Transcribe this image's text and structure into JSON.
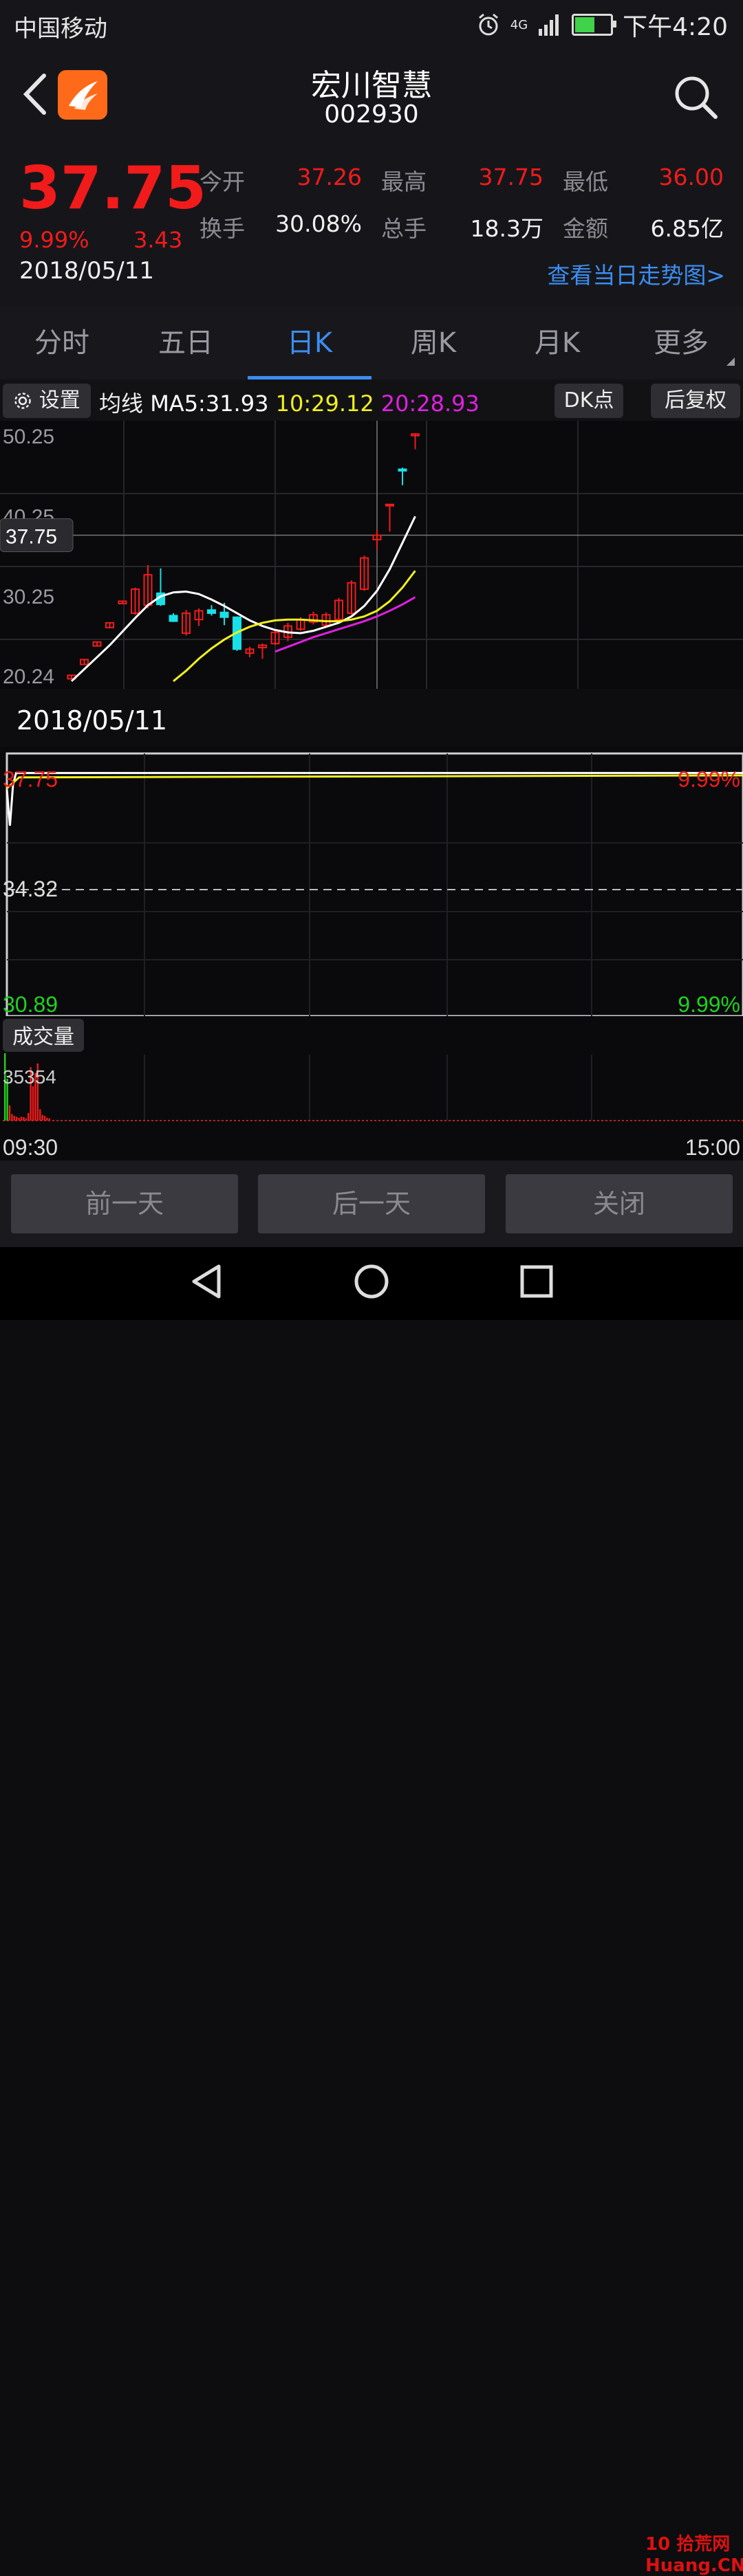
{
  "status_bar": {
    "carrier": "中国移动",
    "network": "4G",
    "time": "下午4:20"
  },
  "header": {
    "title": "宏川智慧",
    "code": "002930"
  },
  "quote": {
    "price": "37.75",
    "change_pct": "9.99%",
    "change": "3.43",
    "date": "2018/05/11",
    "open_label": "今开",
    "open": "37.26",
    "high_label": "最高",
    "high": "37.75",
    "low_label": "最低",
    "low": "36.00",
    "turnover_label": "换手",
    "turnover": "30.08%",
    "volume_label": "总手",
    "volume": "18.3万",
    "amount_label": "金额",
    "amount": "6.85亿",
    "trend_link": "查看当日走势图>"
  },
  "tabs": [
    {
      "label": "分时",
      "active": false
    },
    {
      "label": "五日",
      "active": false
    },
    {
      "label": "日K",
      "active": true
    },
    {
      "label": "周K",
      "active": false
    },
    {
      "label": "月K",
      "active": false
    },
    {
      "label": "更多",
      "active": false
    }
  ],
  "ma_bar": {
    "settings_label": "设置",
    "ma_label": "均线",
    "ma5": "MA5:31.93",
    "ma10": "10:29.12",
    "ma20": "20:28.93",
    "dk_label": "DK点",
    "adjust_label": "后复权"
  },
  "colors": {
    "up": "#f21b1b",
    "down": "#19e0e8",
    "ma5": "#ffffff",
    "ma10": "#f0f01e",
    "ma20": "#e020e0",
    "accent": "#3b8df0",
    "green": "#1fd21f"
  },
  "chart_data": [
    {
      "type": "candlestick",
      "y_ticks": [
        "50.25",
        "40.25",
        "30.25",
        "20.24"
      ],
      "current_price_label": "37.75",
      "candles": [
        {
          "o": 19.8,
          "h": 20.3,
          "l": 19.8,
          "c": 20.24
        },
        {
          "o": 21.6,
          "h": 22.3,
          "l": 21.6,
          "c": 22.2
        },
        {
          "o": 23.9,
          "h": 24.4,
          "l": 23.9,
          "c": 24.4
        },
        {
          "o": 26.2,
          "h": 26.8,
          "l": 26.2,
          "c": 26.8
        },
        {
          "o": 29.2,
          "h": 29.5,
          "l": 29.2,
          "c": 29.5
        },
        {
          "o": 28.0,
          "h": 31.2,
          "l": 27.8,
          "c": 31.0
        },
        {
          "o": 29.0,
          "h": 34.0,
          "l": 28.6,
          "c": 32.8
        },
        {
          "o": 30.5,
          "h": 33.6,
          "l": 28.9,
          "c": 29.1
        },
        {
          "o": 27.7,
          "h": 28.0,
          "l": 26.9,
          "c": 27.0
        },
        {
          "o": 25.5,
          "h": 28.4,
          "l": 25.2,
          "c": 28.0
        },
        {
          "o": 27.2,
          "h": 28.6,
          "l": 26.4,
          "c": 28.3
        },
        {
          "o": 28.4,
          "h": 29.0,
          "l": 27.7,
          "c": 28.0
        },
        {
          "o": 28.1,
          "h": 29.3,
          "l": 26.5,
          "c": 27.5
        },
        {
          "o": 27.5,
          "h": 27.6,
          "l": 23.3,
          "c": 23.5
        },
        {
          "o": 23.0,
          "h": 23.8,
          "l": 22.5,
          "c": 23.5
        },
        {
          "o": 23.7,
          "h": 24.2,
          "l": 22.3,
          "c": 24.0
        },
        {
          "o": 24.2,
          "h": 25.9,
          "l": 24.0,
          "c": 25.6
        },
        {
          "o": 25.0,
          "h": 26.8,
          "l": 24.5,
          "c": 26.4
        },
        {
          "o": 26.0,
          "h": 27.5,
          "l": 25.8,
          "c": 27.2
        },
        {
          "o": 26.9,
          "h": 28.2,
          "l": 26.6,
          "c": 27.8
        },
        {
          "o": 26.5,
          "h": 28.1,
          "l": 26.3,
          "c": 27.8
        },
        {
          "o": 27.2,
          "h": 29.9,
          "l": 26.9,
          "c": 29.6
        },
        {
          "o": 28.0,
          "h": 32.1,
          "l": 27.8,
          "c": 31.8
        },
        {
          "o": 31.0,
          "h": 35.2,
          "l": 30.8,
          "c": 34.9
        },
        {
          "o": 37.2,
          "h": 38.4,
          "l": 36.0,
          "c": 37.75
        },
        {
          "o": 41.5,
          "h": 41.6,
          "l": 38.2,
          "c": 41.6
        },
        {
          "o": 46.0,
          "h": 46.2,
          "l": 44.0,
          "c": 45.8
        },
        {
          "o": 50.2,
          "h": 50.5,
          "l": 48.5,
          "c": 50.4
        }
      ],
      "ma5": [
        19.5,
        21.0,
        22.5,
        24.0,
        25.7,
        27.4,
        29.0,
        30.1,
        30.6,
        30.7,
        30.4,
        29.7,
        28.9,
        28.0,
        27.1,
        26.4,
        25.9,
        25.6,
        25.5,
        25.8,
        26.3,
        26.8,
        27.6,
        28.9,
        30.8,
        33.5,
        36.8,
        40.1
      ],
      "ma10": [
        null,
        null,
        null,
        null,
        null,
        null,
        null,
        null,
        19.5,
        20.8,
        22.3,
        23.6,
        24.7,
        25.6,
        26.3,
        26.8,
        27.1,
        27.2,
        27.2,
        27.1,
        27.0,
        27.0,
        27.2,
        27.6,
        28.3,
        29.5,
        31.2,
        33.3
      ],
      "ma20": [
        null,
        null,
        null,
        null,
        null,
        null,
        null,
        null,
        null,
        null,
        null,
        null,
        null,
        null,
        null,
        null,
        23.2,
        23.8,
        24.4,
        25.0,
        25.5,
        26.0,
        26.5,
        27.0,
        27.6,
        28.3,
        29.1,
        30.0
      ]
    },
    {
      "type": "line",
      "date": "2018/05/11",
      "y_ticks": [
        "37.75",
        "34.32",
        "30.89"
      ],
      "pct_ticks": [
        "9.99%",
        "9.99%"
      ],
      "x_ticks": [
        "09:30",
        "15:00"
      ],
      "price_points": [
        [
          0,
          37.26
        ],
        [
          1,
          36.2
        ],
        [
          2,
          37.4
        ],
        [
          3,
          37.75
        ],
        [
          240,
          37.75
        ]
      ]
    },
    {
      "type": "bar",
      "label": "成交量",
      "max_label": "35354",
      "values": [
        35354,
        22000,
        8000,
        3500,
        2500,
        2000,
        1500,
        2000,
        1800,
        1200,
        4000,
        28000,
        18000,
        25000,
        30000,
        6000,
        3000,
        2500,
        1500,
        1200
      ]
    }
  ],
  "bottom_buttons": {
    "prev": "前一天",
    "next": "后一天",
    "close": "关闭"
  },
  "watermark": "10 拾荒网 Huang.CN"
}
